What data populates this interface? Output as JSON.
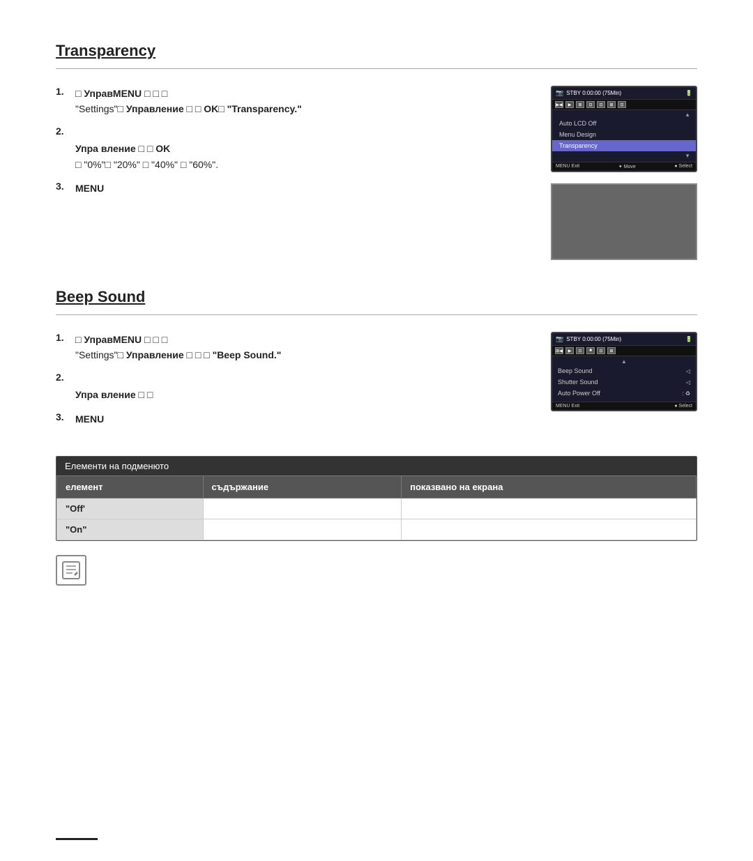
{
  "section1": {
    "title": "Transparency",
    "step1": {
      "number": "1.",
      "text_before": "□",
      "bold1": "УправМЕNUй",
      "text_squares": "□ □ □",
      "text2": "\"Settings\"□",
      "bold2": "Управление",
      "text3": "□ □",
      "bold3": "OK□",
      "quoted": "\"Transparency.\""
    },
    "step2": {
      "number": "2.",
      "bold1": "Упра вление",
      "text1": "□ □",
      "bold2": "OK",
      "text2": "□  \"0%\"□ \"20%\" □ \"40%\" □ \"60%\"."
    },
    "step3": {
      "number": "3.",
      "bold1": "MENU"
    },
    "camera_menu": {
      "status": "STBY 0:00:00 (75Min)",
      "items": [
        "Auto LCD Off",
        "Menu Design",
        "Transparency"
      ],
      "selected_index": 2,
      "bottom": [
        "MENU Exit",
        "✦ Move",
        "● Select"
      ]
    }
  },
  "section2": {
    "title": "Beep Sound",
    "step1": {
      "number": "1.",
      "text_before": "□",
      "bold1": "УправМЕNUй",
      "text_squares": "□ □ □",
      "text2": "\"Settings\"□",
      "bold2": "Управление",
      "text3": "□ □ □",
      "quoted": "\"Beep Sound.\""
    },
    "step2": {
      "number": "2.",
      "bold1": "Упра вление",
      "text1": "□ □"
    },
    "step3": {
      "number": "3.",
      "bold1": "MENU"
    },
    "camera_menu": {
      "status": "STBY 0:00:00 (75Min)",
      "items": [
        "Beep Sound",
        "Shutter Sound",
        "Auto Power Off"
      ],
      "selected_index": -1,
      "bottom": [
        "MENU Exit",
        "● Select"
      ]
    },
    "table": {
      "header": "Елементи на подменюто",
      "col1": "елемент",
      "col2": "съдържание",
      "col3": "показвано на екрана",
      "rows": [
        {
          "item": "\"Off'",
          "content": "",
          "display": ""
        },
        {
          "item": "\"On\"",
          "content": "",
          "display": ""
        }
      ]
    }
  }
}
